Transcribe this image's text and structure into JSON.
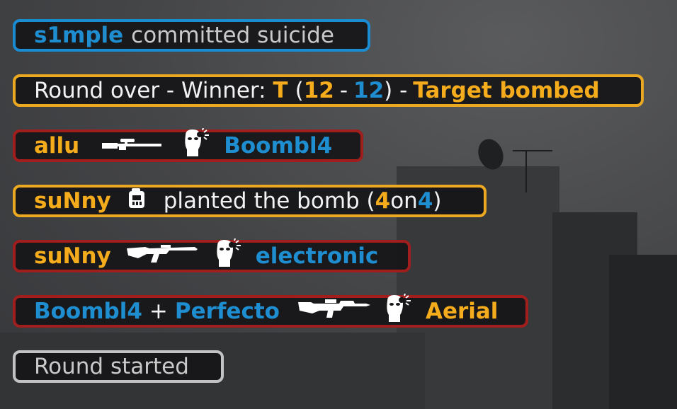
{
  "killfeed": [
    {
      "type": "suicide",
      "player": "s1mple",
      "text": "committed suicide",
      "border": "#1b8cd1"
    },
    {
      "type": "round_over",
      "prefix": "Round over - Winner: ",
      "winner": "T",
      "score_t": "12",
      "score_ct": "12",
      "suffix": "Target bombed",
      "border": "#eba821"
    },
    {
      "type": "kill",
      "attacker": "allu",
      "weapon_icon": "awp-sniper-icon",
      "headshot": true,
      "victim": "Boombl4",
      "border": "#a11e1e"
    },
    {
      "type": "plant",
      "player": "suNny",
      "bomb_icon": "c4-bomb-icon",
      "text": "planted the bomb (",
      "t_count": "4",
      "mid": "on",
      "ct_count": "4",
      "close": ")",
      "border": "#eba821"
    },
    {
      "type": "kill",
      "attacker": "suNny",
      "weapon_icon": "ak47-rifle-icon",
      "headshot": true,
      "victim": "electronic",
      "border": "#a11e1e"
    },
    {
      "type": "kill_assist",
      "attacker": "Boombl4",
      "plus": "+",
      "assister": "Perfecto",
      "weapon_icon": "m4-rifle-icon",
      "headshot": true,
      "victim": "Aerial",
      "border": "#a11e1e"
    },
    {
      "type": "round_start",
      "text": "Round started",
      "border": "#c3c3c3"
    }
  ],
  "colors": {
    "t_team": "#f4ab1c",
    "ct_team": "#1e8ed1",
    "panel_bg": "#161618"
  }
}
